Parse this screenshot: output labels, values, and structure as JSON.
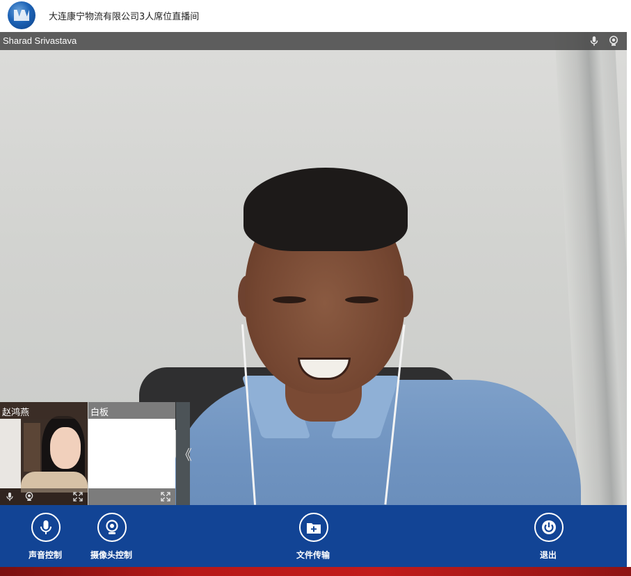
{
  "header": {
    "logo_icon": "company-logo",
    "room_title": "大连康宁物流有限公司3人席位直播间"
  },
  "main_video": {
    "speaker_name": "Sharad Srivastava",
    "icons": [
      "microphone-icon",
      "camera-icon"
    ]
  },
  "thumbnails": [
    {
      "label": "赵鸿燕",
      "icons": [
        "microphone-icon",
        "camera-icon",
        "fullscreen-icon"
      ]
    },
    {
      "label": "白板",
      "icons": [
        "fullscreen-icon"
      ]
    }
  ],
  "collapse": {
    "glyph": "《"
  },
  "toolbar": {
    "audio_label": "声音控制",
    "camera_label": "摄像头控制",
    "file_label": "文件传输",
    "exit_label": "退出"
  },
  "colors": {
    "toolbar_bg": "#124495",
    "bottom_strip": "#b71818"
  }
}
